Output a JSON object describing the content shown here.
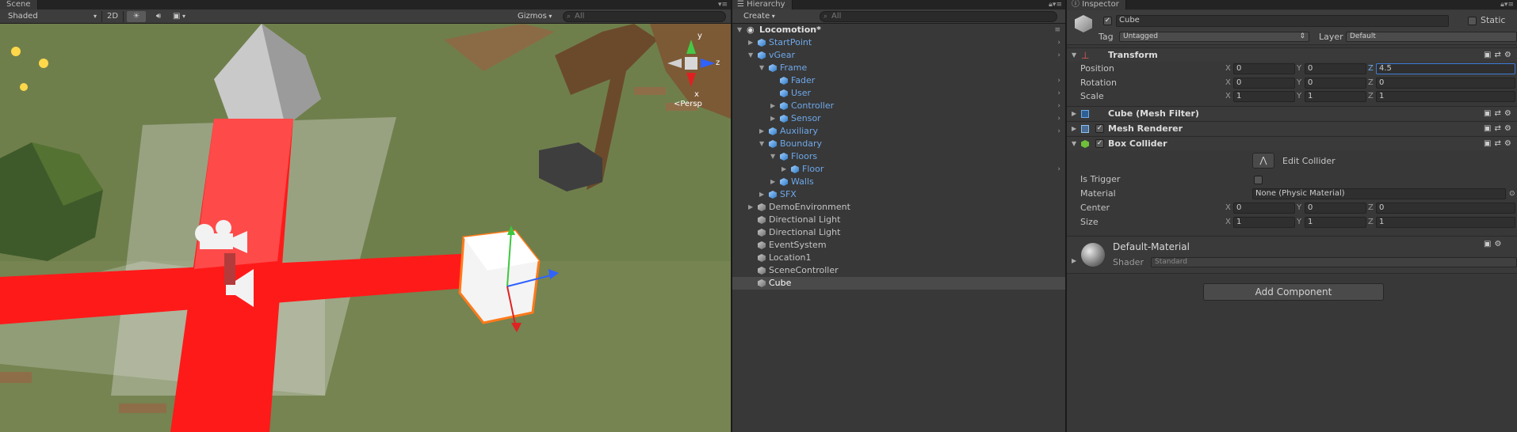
{
  "colors": {
    "selection": "#4a4a4a",
    "accent_blue": "#6ea8ea",
    "floor_red": "#ff1a1a",
    "scene_green": "#6f7f4c"
  },
  "scene": {
    "tab": "Scene",
    "shading": "Shaded",
    "mode_2d": "2D",
    "gizmos": "Gizmos",
    "search_placeholder": "All",
    "persp": "<Persp",
    "axis_y": "y",
    "axis_z": "z",
    "axis_x": "x",
    "icons": [
      "sun-icon",
      "audio-icon",
      "image-icon"
    ]
  },
  "hierarchy": {
    "tab": "Hierarchy",
    "create": "Create",
    "search_placeholder": "All",
    "root": "Locomotion*",
    "items": [
      {
        "label": "StartPoint",
        "depth": 1,
        "arrow": "▶",
        "blue": true,
        "more": true
      },
      {
        "label": "vGear",
        "depth": 1,
        "arrow": "▼",
        "blue": true,
        "more": true
      },
      {
        "label": "Frame",
        "depth": 2,
        "arrow": "▼",
        "blue": true,
        "more": false
      },
      {
        "label": "Fader",
        "depth": 3,
        "arrow": "",
        "blue": true,
        "more": true
      },
      {
        "label": "User",
        "depth": 3,
        "arrow": "",
        "blue": true,
        "more": true
      },
      {
        "label": "Controller",
        "depth": 3,
        "arrow": "▶",
        "blue": true,
        "more": true
      },
      {
        "label": "Sensor",
        "depth": 3,
        "arrow": "▶",
        "blue": true,
        "more": true
      },
      {
        "label": "Auxiliary",
        "depth": 2,
        "arrow": "▶",
        "blue": true,
        "more": true
      },
      {
        "label": "Boundary",
        "depth": 2,
        "arrow": "▼",
        "blue": true,
        "more": false
      },
      {
        "label": "Floors",
        "depth": 3,
        "arrow": "▼",
        "blue": true,
        "more": false
      },
      {
        "label": "Floor",
        "depth": 4,
        "arrow": "▶",
        "blue": true,
        "more": true
      },
      {
        "label": "Walls",
        "depth": 3,
        "arrow": "▶",
        "blue": true,
        "more": false
      },
      {
        "label": "SFX",
        "depth": 2,
        "arrow": "▶",
        "blue": true,
        "more": false
      },
      {
        "label": "DemoEnvironment",
        "depth": 1,
        "arrow": "▶",
        "blue": false,
        "more": false
      },
      {
        "label": "Directional Light",
        "depth": 1,
        "arrow": "",
        "blue": false,
        "more": false
      },
      {
        "label": "Directional Light",
        "depth": 1,
        "arrow": "",
        "blue": false,
        "more": false
      },
      {
        "label": "EventSystem",
        "depth": 1,
        "arrow": "",
        "blue": false,
        "more": false
      },
      {
        "label": "Location1",
        "depth": 1,
        "arrow": "",
        "blue": false,
        "more": false
      },
      {
        "label": "SceneController",
        "depth": 1,
        "arrow": "",
        "blue": false,
        "more": false
      },
      {
        "label": "Cube",
        "depth": 1,
        "arrow": "",
        "blue": false,
        "more": false,
        "selected": true
      }
    ]
  },
  "inspector": {
    "tab": "Inspector",
    "object_name": "Cube",
    "static_label": "Static",
    "tag_label": "Tag",
    "tag_value": "Untagged",
    "layer_label": "Layer",
    "layer_value": "Default",
    "transform": {
      "title": "Transform",
      "position": {
        "label": "Position",
        "x": "0",
        "y": "0",
        "z": "4.5"
      },
      "rotation": {
        "label": "Rotation",
        "x": "0",
        "y": "0",
        "z": "0"
      },
      "scale": {
        "label": "Scale",
        "x": "1",
        "y": "1",
        "z": "1"
      }
    },
    "mesh_filter": "Cube (Mesh Filter)",
    "mesh_renderer": "Mesh Renderer",
    "box_collider": {
      "title": "Box Collider",
      "edit_collider": "Edit Collider",
      "is_trigger": "Is Trigger",
      "material_label": "Material",
      "material_value": "None (Physic Material)",
      "center": {
        "label": "Center",
        "x": "0",
        "y": "0",
        "z": "0"
      },
      "size": {
        "label": "Size",
        "x": "1",
        "y": "1",
        "z": "1"
      }
    },
    "material": {
      "name": "Default-Material",
      "shader_label": "Shader",
      "shader_value": "Standard"
    },
    "add_component": "Add Component",
    "axis_x": "X",
    "axis_y": "Y",
    "axis_z": "Z"
  }
}
